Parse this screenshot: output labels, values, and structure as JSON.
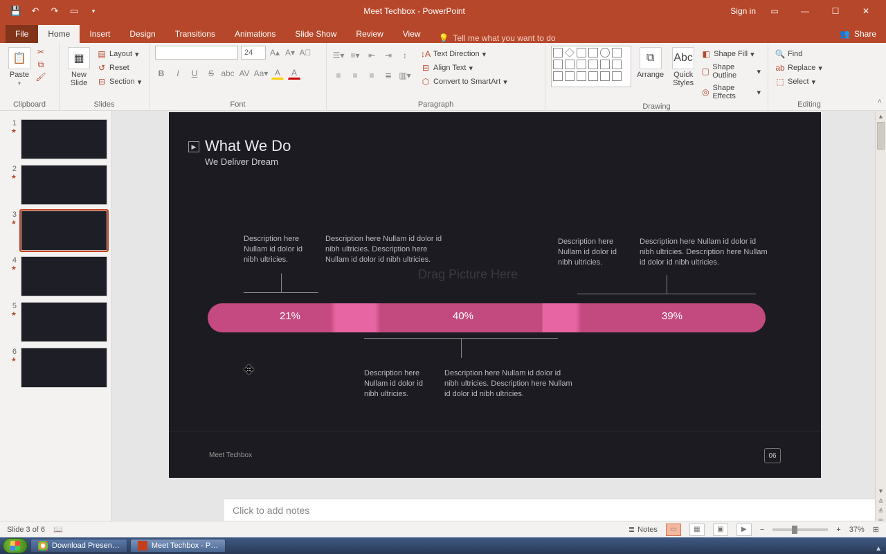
{
  "titlebar": {
    "title": "Meet Techbox - PowerPoint",
    "signin": "Sign in"
  },
  "tabs": {
    "file": "File",
    "home": "Home",
    "insert": "Insert",
    "design": "Design",
    "transitions": "Transitions",
    "animations": "Animations",
    "slideshow": "Slide Show",
    "review": "Review",
    "view": "View",
    "tellme": "Tell me what you want to do",
    "share": "Share"
  },
  "ribbon": {
    "clipboard": {
      "label": "Clipboard",
      "paste": "Paste"
    },
    "slides": {
      "label": "Slides",
      "newslide": "New\nSlide",
      "layout": "Layout",
      "reset": "Reset",
      "section": "Section"
    },
    "font": {
      "label": "Font",
      "size": "24"
    },
    "paragraph": {
      "label": "Paragraph",
      "textdir": "Text Direction",
      "align": "Align Text",
      "smartart": "Convert to SmartArt"
    },
    "drawing": {
      "label": "Drawing",
      "arrange": "Arrange",
      "quick": "Quick\nStyles",
      "fill": "Shape Fill",
      "outline": "Shape Outline",
      "effects": "Shape Effects"
    },
    "editing": {
      "label": "Editing",
      "find": "Find",
      "replace": "Replace",
      "select": "Select"
    }
  },
  "thumbs": [
    {
      "n": "1"
    },
    {
      "n": "2"
    },
    {
      "n": "3"
    },
    {
      "n": "4"
    },
    {
      "n": "5"
    },
    {
      "n": "6"
    }
  ],
  "slide": {
    "title": "What We Do",
    "subtitle": "We Deliver Dream",
    "dragbg": "Drag Picture Here",
    "desc_top_left": "Description here Nullam id dolor id nibh ultricies.",
    "desc_top_mid": "Description here Nullam id dolor id nibh ultricies. Description here Nullam id dolor id nibh ultricies.",
    "desc_top_r1": "Description here Nullam id dolor id nibh ultricies.",
    "desc_top_r2": "Description here Nullam id dolor id nibh ultricies. Description here Nullam id dolor id nibh ultricies.",
    "desc_bot_left": "Description here Nullam id dolor id nibh ultricies.",
    "desc_bot_right": "Description here Nullam id dolor id nibh ultricies. Description here Nullam id dolor id nibh ultricies.",
    "pct1": "21%",
    "pct2": "40%",
    "pct3": "39%",
    "footer": "Meet Techbox",
    "page": "06"
  },
  "notes_placeholder": "Click to add notes",
  "status": {
    "slide": "Slide 3 of 6",
    "notes": "Notes",
    "zoom": "37%"
  },
  "taskbar": {
    "chrome": "Download Presen…",
    "ppt": "Meet Techbox - P…"
  }
}
